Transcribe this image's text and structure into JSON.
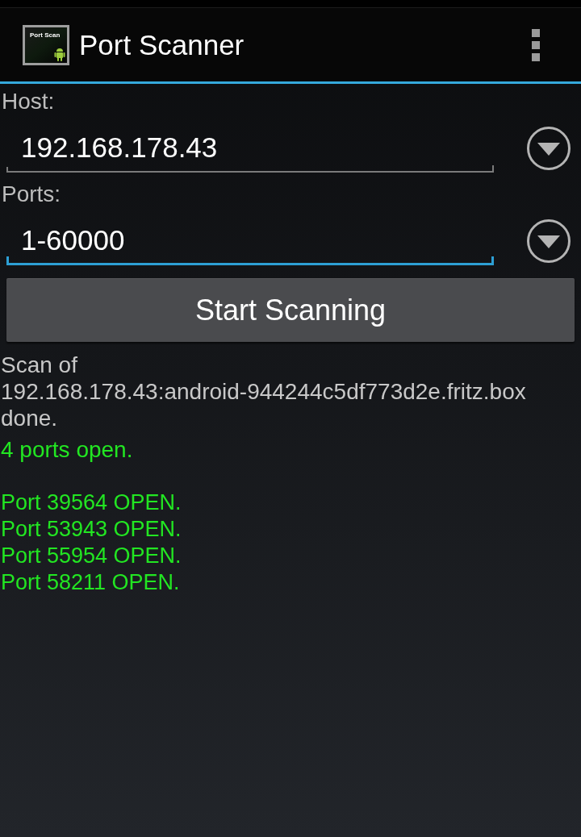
{
  "action_bar": {
    "logo_text": "Port Scan",
    "title": "Port Scanner"
  },
  "form": {
    "fields": [
      {
        "label": "Host:",
        "value": "192.168.178.43",
        "focused": false
      },
      {
        "label": "Ports:",
        "value": "1-60000",
        "focused": true
      }
    ],
    "button": "Start Scanning"
  },
  "output": {
    "scan_message": "Scan of 192.168.178.43:android-944244c5df773d2e.fritz.box done.",
    "summary": "4 ports open.",
    "ports": [
      "Port 39564 OPEN.",
      "Port 53943 OPEN.",
      "Port 55954 OPEN.",
      "Port 58211 OPEN."
    ]
  }
}
